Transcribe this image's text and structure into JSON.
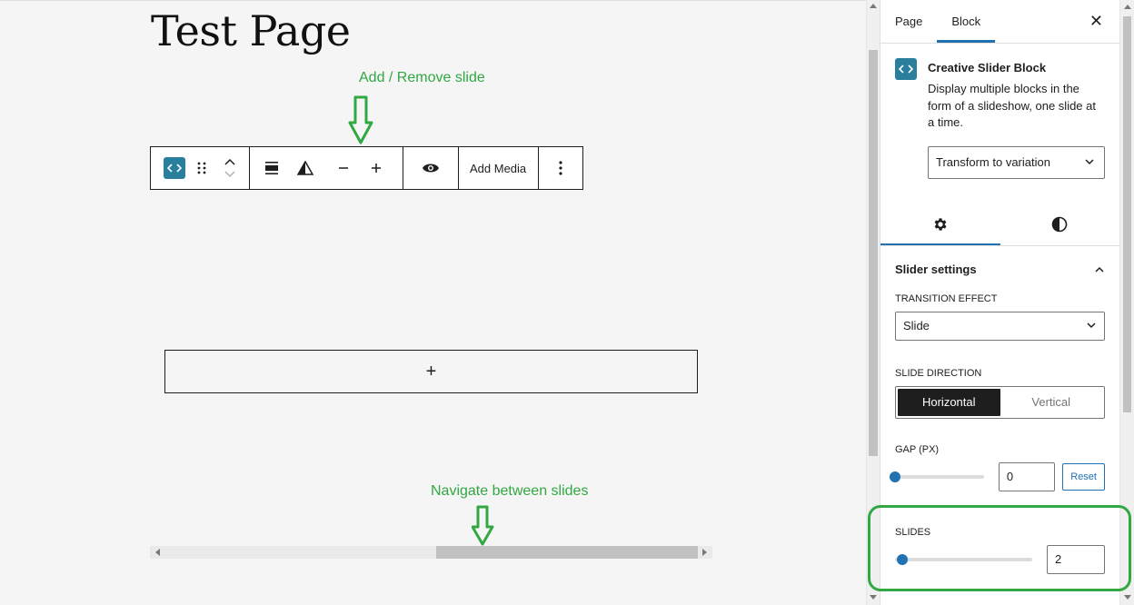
{
  "editor": {
    "page_title": "Test Page",
    "annotation_top": "Add / Remove slide",
    "annotation_bottom": "Navigate between slides",
    "toolbar": {
      "add_media_label": "Add Media"
    },
    "appender_label": "+"
  },
  "sidebar": {
    "tabs": [
      {
        "label": "Page",
        "active": false
      },
      {
        "label": "Block",
        "active": true
      }
    ],
    "close_label": "✕",
    "block": {
      "title": "Creative Slider Block",
      "description": "Display multiple blocks in the form of a slideshow, one slide at a time.",
      "variation_select": "Transform to variation"
    },
    "panel_tabs": [
      {
        "icon": "gear-icon",
        "active": true
      },
      {
        "icon": "contrast-icon",
        "active": false
      }
    ],
    "slider_settings": {
      "heading": "Slider settings",
      "transition_label": "TRANSITION EFFECT",
      "transition_value": "Slide",
      "direction_label": "SLIDE DIRECTION",
      "direction_options": [
        "Horizontal",
        "Vertical"
      ],
      "direction_selected": "Horizontal",
      "gap_label": "GAP (PX)",
      "gap_value": "0",
      "gap_reset_label": "Reset",
      "slides_label": "SLIDES",
      "slides_value": "2"
    }
  },
  "colors": {
    "annotation": "#31a842",
    "accent": "#2271b1",
    "block_icon": "#2a7f9c"
  }
}
